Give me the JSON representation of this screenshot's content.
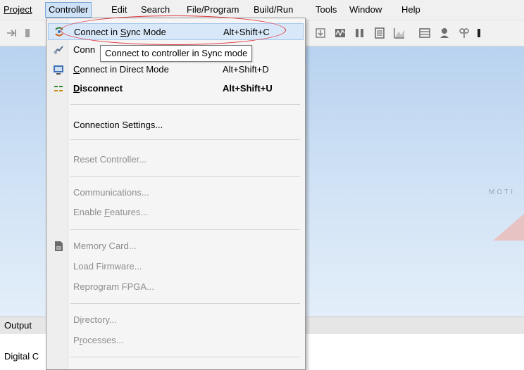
{
  "menubar": {
    "items": [
      "Project",
      "Controller",
      "Edit",
      "Search",
      "File/Program",
      "Build/Run",
      "Tools",
      "Window",
      "Help"
    ]
  },
  "dropdown": {
    "items": [
      {
        "label": "Connect in Sync Mode",
        "shortcut": "Alt+Shift+C",
        "icon": "sync-connect-icon"
      },
      {
        "label": "Conn",
        "shortcut": "",
        "icon": "async-connect-icon"
      },
      {
        "label": "Connect in Direct Mode",
        "shortcut": "Alt+Shift+D",
        "icon": "direct-connect-icon"
      },
      {
        "label": "Disconnect",
        "shortcut": "Alt+Shift+U",
        "icon": "disconnect-icon"
      },
      {
        "label": "Connection Settings..."
      },
      {
        "label": "Reset Controller..."
      },
      {
        "label": "Communications..."
      },
      {
        "label": "Enable Features..."
      },
      {
        "label": "Memory Card...",
        "icon": "memory-card-icon"
      },
      {
        "label": "Load Firmware..."
      },
      {
        "label": "Reprogram FPGA..."
      },
      {
        "label": "Directory..."
      },
      {
        "label": "Processes..."
      }
    ]
  },
  "tooltip": "Connect to controller in Sync mode",
  "output": {
    "tab_label": "Output",
    "line": "Digital C"
  },
  "background_logo_text": "MOTI",
  "colors": {
    "highlight_ellipse": "#e0353d",
    "menu_highlight": "#d9e8f8",
    "desktop_gradient_top": "#b8d2ef"
  }
}
